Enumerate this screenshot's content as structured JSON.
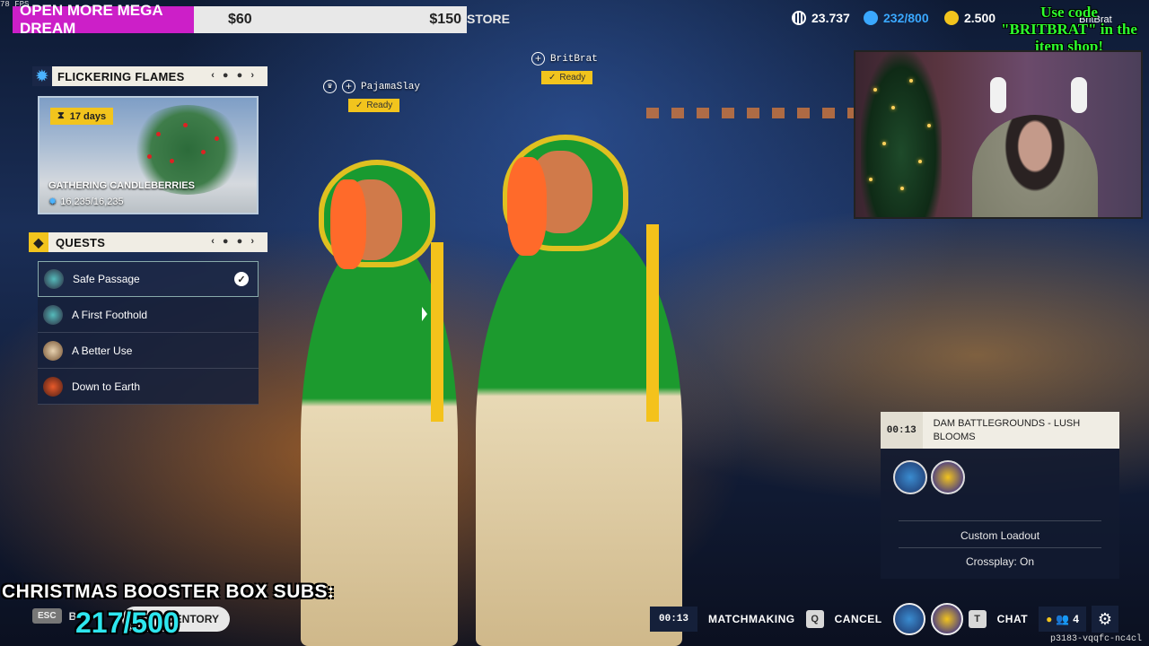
{
  "overlay": {
    "fps": "78 FPS",
    "promo": {
      "title": "OPEN MORE MEGA DREAM",
      "value_start": "$60",
      "value_end": "$150"
    },
    "promo_code": "Use code \"BRITBRAT\" in the item shop!",
    "streamer_name": "BritBrat",
    "christmas_text": "CHRISTMAS BOOSTER BOX SUBS:",
    "subs_count": "217/500"
  },
  "header": {
    "store_label": "STORE",
    "currencies": [
      {
        "icon": "credits-icon",
        "value": "23.737",
        "color": "#ffffff"
      },
      {
        "icon": "tokens-icon",
        "value": "232/800",
        "color": "#3aa8ff"
      },
      {
        "icon": "coins-icon",
        "value": "2.500",
        "color": "#f2c41d"
      }
    ]
  },
  "event": {
    "title": "FLICKERING FLAMES",
    "time_left": "17 days",
    "card_title": "GATHERING CANDLEBERRIES",
    "progress": "16,235/16,235"
  },
  "quests": {
    "title": "QUESTS",
    "items": [
      {
        "label": "Safe Passage",
        "completed": true
      },
      {
        "label": "A First Foothold",
        "completed": false
      },
      {
        "label": "A Better Use",
        "completed": false
      },
      {
        "label": "Down to Earth",
        "completed": false
      }
    ]
  },
  "lobby": {
    "players": [
      {
        "name": "PajamaSlay",
        "status": "Ready"
      },
      {
        "name": "BritBrat",
        "status": "Ready"
      }
    ]
  },
  "match": {
    "timer": "00:13",
    "mode": "DAM BATTLEGROUNDS - LUSH BLOOMS",
    "loadout": "Custom Loadout",
    "crossplay": "Crossplay: On"
  },
  "bottom": {
    "esc_key": "ESC",
    "back_label": "B",
    "inventory_label": "INVENTORY",
    "timer": "00:13",
    "matchmaking_label": "MATCHMAKING",
    "cancel_key": "Q",
    "cancel_label": "CANCEL",
    "chat_key": "T",
    "chat_label": "CHAT",
    "party_count": "4",
    "session_id": "p3183-vqqfc-nc4cl"
  }
}
